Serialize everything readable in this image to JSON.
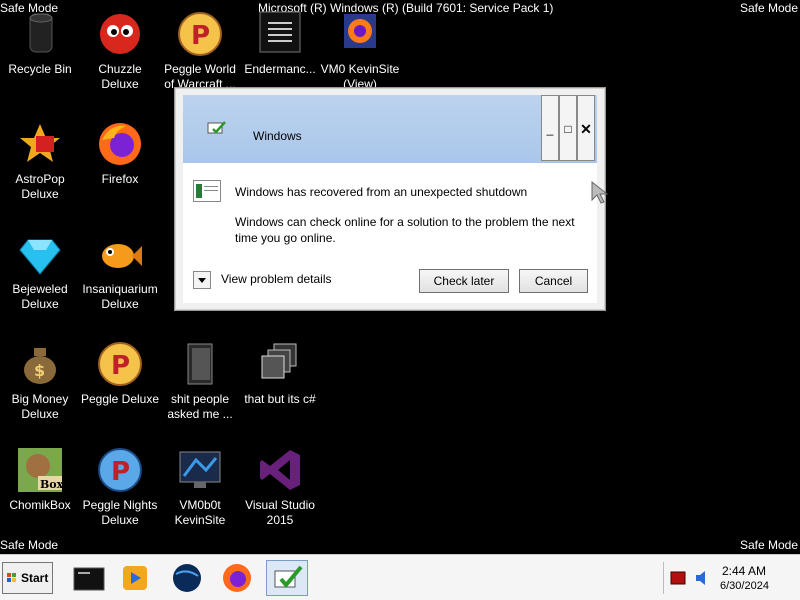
{
  "safe_mode": {
    "label": "Safe Mode"
  },
  "build_text": "Microsoft (R) Windows (R) (Build 7601: Service Pack 1)",
  "desktop_icons": [
    {
      "label": "Recycle Bin"
    },
    {
      "label": "Chuzzle Deluxe"
    },
    {
      "label": "Peggle World of Warcraft ..."
    },
    {
      "label": "Endermanc..."
    },
    {
      "label": "VM0 KevinSite (View)"
    },
    {
      "label": "AstroPop Deluxe"
    },
    {
      "label": "Firefox"
    },
    {
      "label": "Bejeweled Deluxe"
    },
    {
      "label": "Insaniquarium Deluxe"
    },
    {
      "label": "Big Money Deluxe"
    },
    {
      "label": "Peggle Deluxe"
    },
    {
      "label": "shit people asked me ..."
    },
    {
      "label": "that but its c#"
    },
    {
      "label": "ChomikBox"
    },
    {
      "label": "Peggle Nights Deluxe"
    },
    {
      "label": "VM0b0t KevinSite"
    },
    {
      "label": "Visual Studio 2015"
    }
  ],
  "dialog": {
    "title": "Windows",
    "heading": "Windows has recovered from an unexpected shutdown",
    "body": "Windows can check online for a solution to the problem the next time you go online.",
    "details_label": "View problem details",
    "check_later": "Check later",
    "cancel": "Cancel",
    "minimize": "_",
    "maximize": "□",
    "close": "✕"
  },
  "taskbar": {
    "start_label": "Start",
    "time": "2:44 AM",
    "date": "6/30/2024"
  }
}
